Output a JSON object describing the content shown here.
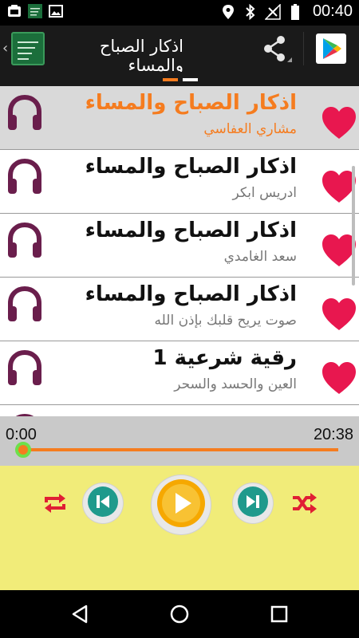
{
  "status_bar": {
    "time": "00:40",
    "left_icons": [
      "app-notification-icon",
      "app-notification-icon-2",
      "image-icon"
    ],
    "right_icons": [
      "location-icon",
      "bluetooth-icon",
      "signal-icon",
      "battery-icon"
    ]
  },
  "action_bar": {
    "title": "اذكار الصباح والمساء",
    "icons": [
      "back-chevron-icon",
      "app-icon",
      "share-icon",
      "play-store-icon"
    ]
  },
  "tabs": {
    "count": 2,
    "active_index": 0,
    "active_color": "#f57c1f",
    "inactive_color": "#ffffff"
  },
  "tracks": [
    {
      "title": "اذكار الصباح والمساء",
      "subtitle": "مشاري العفاسي",
      "selected": true
    },
    {
      "title": "اذكار الصباح والمساء",
      "subtitle": "ادريس ابكر",
      "selected": false
    },
    {
      "title": "اذكار الصباح والمساء",
      "subtitle": "سعد الغامدي",
      "selected": false
    },
    {
      "title": "اذكار الصباح والمساء",
      "subtitle": "صوت يريح قلبك بإذن الله",
      "selected": false
    },
    {
      "title": "رقية شرعية 1",
      "subtitle": "العين والحسد والسحر",
      "selected": false
    }
  ],
  "player": {
    "current_time": "0:00",
    "total_time": "20:38",
    "progress": 0.0,
    "buttons": [
      "repeat-icon",
      "previous-icon",
      "play-icon",
      "next-icon",
      "shuffle-icon"
    ]
  },
  "colors": {
    "accent": "#f57c1f",
    "heart": "#e8174f",
    "headphones": "#6a1e4c",
    "controls_bg": "#f1ec79",
    "control_red": "#e01e34",
    "control_teal": "#1f9a8c"
  },
  "nav_bar": {
    "icons": [
      "back-icon",
      "home-icon",
      "recents-icon"
    ]
  }
}
